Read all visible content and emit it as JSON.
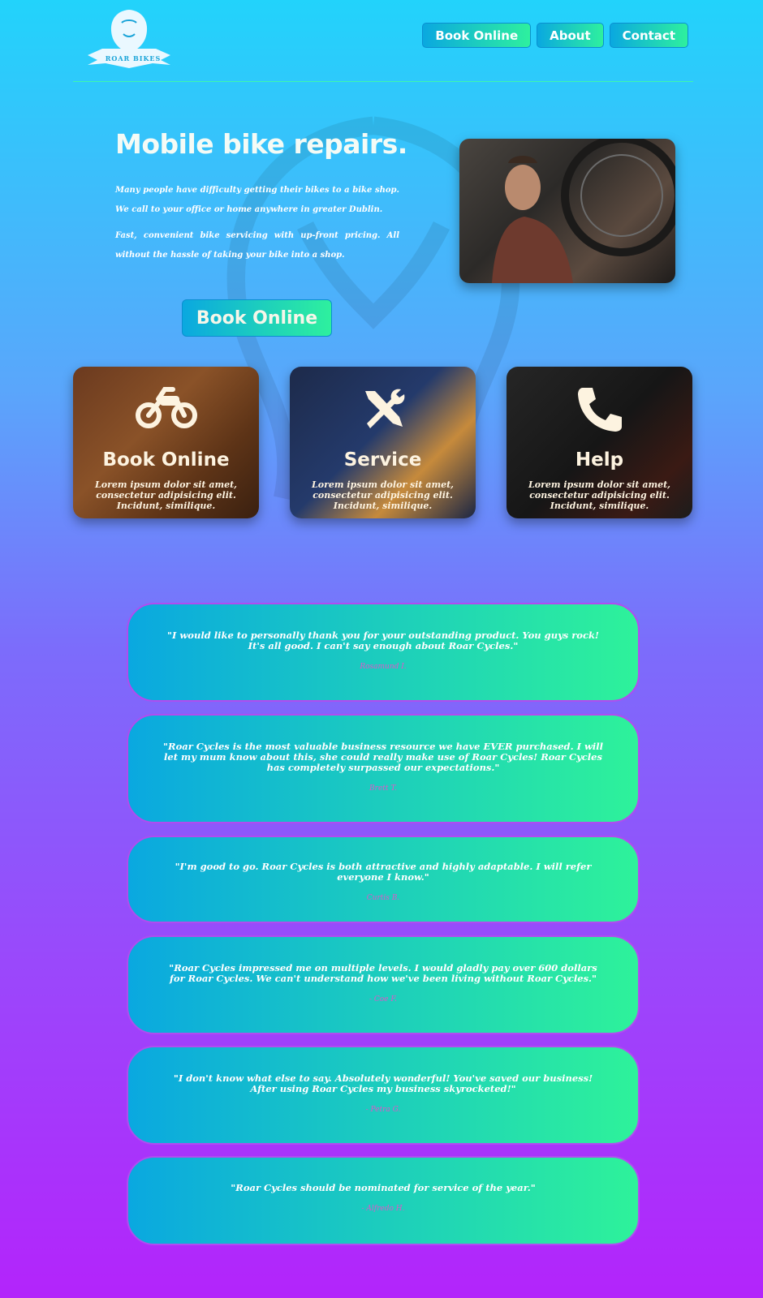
{
  "brand": {
    "logo_text": "ROAR BIKES"
  },
  "nav": [
    {
      "label": "Book Online"
    },
    {
      "label": "About"
    },
    {
      "label": "Contact"
    }
  ],
  "hero": {
    "title": "Mobile bike repairs.",
    "paragraphs": [
      "Many people have difficulty getting their bikes to a bike shop. We call to your office or home anywhere in greater Dublin.",
      "Fast, convenient bike servicing with up-front pricing. All without the hassle of taking your bike into a shop."
    ],
    "cta_label": "Book Online"
  },
  "cards": [
    {
      "title": "Book Online",
      "text": "Lorem ipsum dolor sit amet, consectetur adipisicing elit. Incidunt, similique.",
      "icon": "motorcycle-icon"
    },
    {
      "title": "Service",
      "text": "Lorem ipsum dolor sit amet, consectetur adipisicing elit. Incidunt, similique.",
      "icon": "tools-icon"
    },
    {
      "title": "Help",
      "text": "Lorem ipsum dolor sit amet, consectetur adipisicing elit. Incidunt, similique.",
      "icon": "phone-icon"
    }
  ],
  "testimonials": [
    {
      "quote": "\"I would like to personally thank you for your outstanding product. You guys rock! It's all good. I can't say enough about Roar Cycles.\"",
      "author": "Rosamund I."
    },
    {
      "quote": "\"Roar Cycles is the most valuable business resource we have EVER purchased. I will let my mum know about this, she could really make use of Roar Cycles! Roar Cycles has completely surpassed our expectations.\"",
      "author": "Brett T."
    },
    {
      "quote": "\"I'm good to go. Roar Cycles is both attractive and highly adaptable. I will refer everyone I know.\"",
      "author": "Curtis B."
    },
    {
      "quote": "\"Roar Cycles impressed me on multiple levels. I would gladly pay over 600 dollars for Roar Cycles. We can't understand how we've been living without Roar Cycles.\"",
      "author": "- Coe F."
    },
    {
      "quote": "\"I don't know what else to say. Absolutely wonderful! You've saved our business! After using Roar Cycles my business skyrocketed!\"",
      "author": "- Petra G."
    },
    {
      "quote": "\"Roar Cycles should be nominated for service of the year.\"",
      "author": "- Alfredo H."
    }
  ],
  "colors": {
    "accent_start": "#0aa8e0",
    "accent_end": "#2ef09e",
    "author": "#e056c8"
  }
}
